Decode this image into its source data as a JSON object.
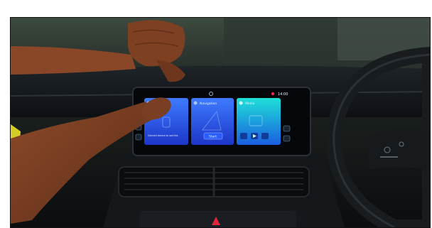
{
  "screen": {
    "status": {
      "time": "14:00"
    },
    "cards": [
      {
        "id": "phone",
        "title": "Phone",
        "caption": "Connect device to use this"
      },
      {
        "id": "navigation",
        "title": "Navigation",
        "button_label": "Start"
      },
      {
        "id": "media",
        "title": "Media"
      }
    ]
  },
  "colors": {
    "card_blue": "#2a56ff",
    "card_teal": "#11c3cf",
    "dashboard": "#111417",
    "skin": "#7a3f22",
    "sleeve": "#d6cc27"
  },
  "icons": [
    "home-icon",
    "phone-icon",
    "navigation-icon",
    "media-icon",
    "play-icon",
    "skip-icon",
    "settings-icon",
    "hazard-icon"
  ]
}
